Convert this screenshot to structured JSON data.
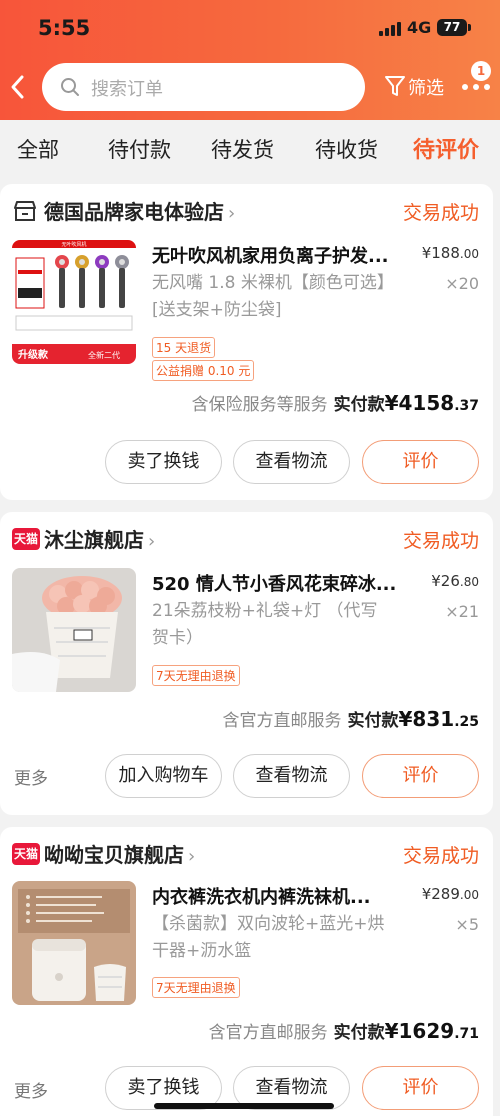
{
  "status_bar": {
    "time": "5:55",
    "network": "4G",
    "battery": "77"
  },
  "header": {
    "search_placeholder": "搜索订单",
    "filter_label": "筛选",
    "more_badge": "1"
  },
  "tabs": [
    {
      "label": "全部"
    },
    {
      "label": "待付款"
    },
    {
      "label": "待发货"
    },
    {
      "label": "待收货"
    },
    {
      "label": "待评价",
      "active": true
    }
  ],
  "orders": [
    {
      "store_name": "德国品牌家电体验店",
      "store_badge": "",
      "status": "交易成功",
      "title": "无叶吹风机家用负离子护发...",
      "price_main": "¥188",
      "price_dec": ".00",
      "qty": "×20",
      "variant": "无风嘴 1.8 米裸机【颜色可选】[送支架+防尘袋]",
      "tags": [
        "15 天退货",
        "公益捐赠 0.10 元"
      ],
      "service": "含保险服务等服务",
      "paid_label": "实付款",
      "paid_main": "¥4158",
      "paid_dec": ".37",
      "more_label": "",
      "buttons": [
        "卖了换钱",
        "查看物流",
        "评价"
      ],
      "thumb": {
        "top_label": "无叶吹风机",
        "badge": "升级款",
        "sub": "全新二代"
      }
    },
    {
      "store_name": "沐尘旗舰店",
      "store_badge": "天猫",
      "status": "交易成功",
      "title": "520 情人节小香风花束碎冰...",
      "price_main": "¥26",
      "price_dec": ".80",
      "qty": "×21",
      "variant": "21朵荔枝粉+礼袋+灯 （代写贺卡）",
      "tags": [
        "7天无理由退换"
      ],
      "service": "含官方直邮服务",
      "paid_label": "实付款",
      "paid_main": "¥831",
      "paid_dec": ".25",
      "more_label": "更多",
      "buttons": [
        "加入购物车",
        "查看物流",
        "评价"
      ]
    },
    {
      "store_name": "呦呦宝贝旗舰店",
      "store_badge": "天猫",
      "status": "交易成功",
      "title": "内衣裤洗衣机内裤洗袜机...",
      "price_main": "¥289",
      "price_dec": ".00",
      "qty": "×5",
      "variant": "【杀菌款】双向波轮+蓝光+烘干器+沥水篮",
      "tags": [
        "7天无理由退换"
      ],
      "service": "含官方直邮服务",
      "paid_label": "实付款",
      "paid_main": "¥1629",
      "paid_dec": ".71",
      "more_label": "更多",
      "buttons": [
        "卖了换钱",
        "查看物流",
        "评价"
      ]
    }
  ],
  "colors": {
    "accent": "#f05c23",
    "header_start": "#f7553a",
    "header_end": "#f78247",
    "tmall_red": "#e8183a"
  }
}
